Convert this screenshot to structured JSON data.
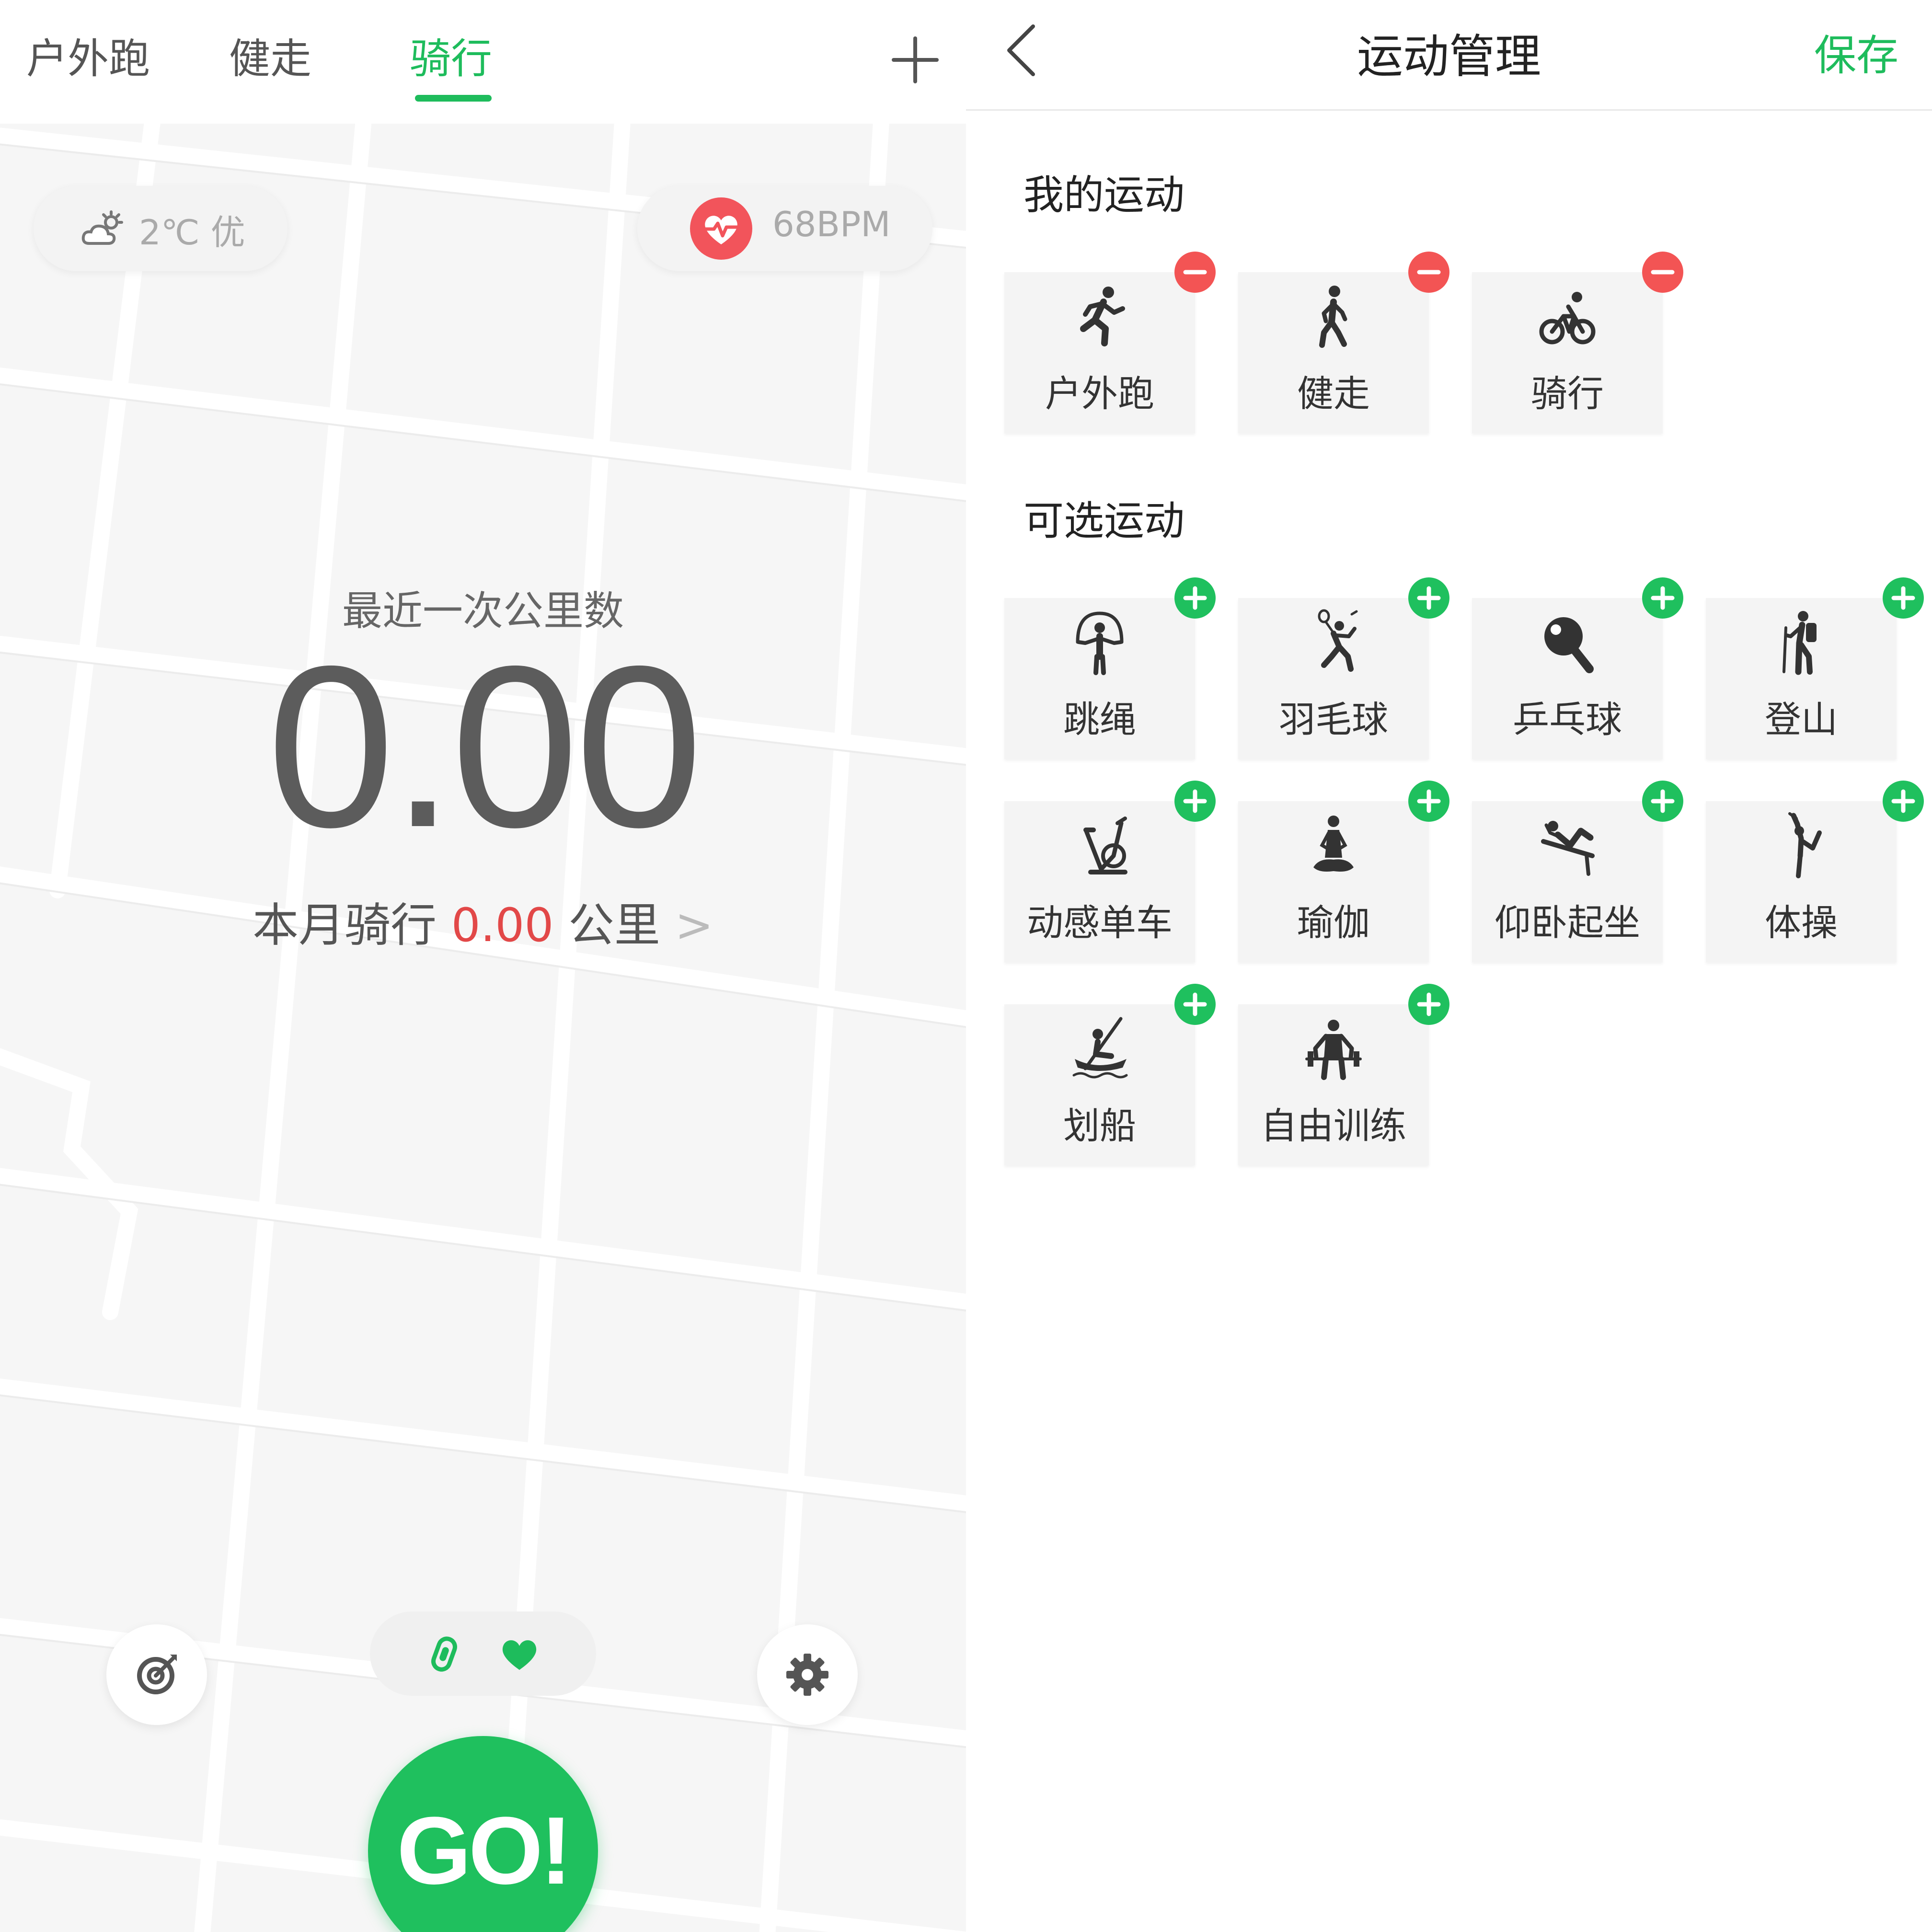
{
  "colors": {
    "accent": "#1ebc5c",
    "danger": "#f35454",
    "highlight_value": "#e24848",
    "map_background": "#f6f6f6"
  },
  "left": {
    "tabs": [
      {
        "label": "户外跑",
        "active": false
      },
      {
        "label": "健走",
        "active": false
      },
      {
        "label": "骑行",
        "active": true
      }
    ],
    "weather": {
      "icon": "partly-cloudy-icon",
      "temperature": "2℃",
      "air_quality": "优"
    },
    "heart_rate": {
      "icon": "heartbeat-icon",
      "value": "68BPM"
    },
    "recent_label": "最近一次公里数",
    "recent_distance": "0.00",
    "month": {
      "prefix": "本月骑行",
      "value": "0.00",
      "unit": "公里",
      "chevron": ">"
    },
    "devices": [
      {
        "icon": "band-icon"
      },
      {
        "icon": "heart-icon"
      }
    ],
    "go_label": "GO!",
    "bottom_left_icon": "target-icon",
    "bottom_right_icon": "gear-icon"
  },
  "right": {
    "title": "运动管理",
    "save_label": "保存",
    "my_sports_title": "我的运动",
    "my_sports": [
      {
        "label": "户外跑",
        "icon": "run-icon"
      },
      {
        "label": "健走",
        "icon": "walk-icon"
      },
      {
        "label": "骑行",
        "icon": "bike-icon"
      }
    ],
    "optional_sports_title": "可选运动",
    "optional_sports": [
      {
        "label": "跳绳",
        "icon": "jump-rope-icon"
      },
      {
        "label": "羽毛球",
        "icon": "badminton-icon"
      },
      {
        "label": "乒乓球",
        "icon": "table-tennis-icon"
      },
      {
        "label": "登山",
        "icon": "hiking-icon"
      },
      {
        "label": "动感单车",
        "icon": "spin-bike-icon"
      },
      {
        "label": "瑜伽",
        "icon": "yoga-icon"
      },
      {
        "label": "仰卧起坐",
        "icon": "situp-icon"
      },
      {
        "label": "体操",
        "icon": "gymnastics-icon"
      },
      {
        "label": "划船",
        "icon": "rowing-icon"
      },
      {
        "label": "自由训练",
        "icon": "weightlifting-icon"
      }
    ]
  }
}
